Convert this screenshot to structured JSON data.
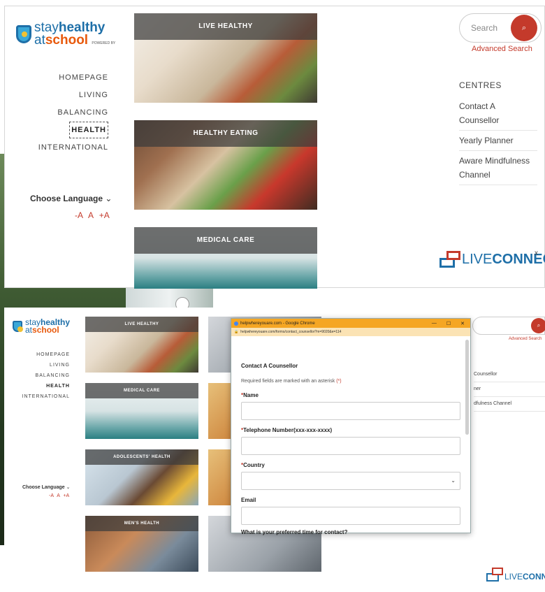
{
  "logo": {
    "line1_a": "stay",
    "line1_b": "healthy",
    "line2_a": "at",
    "line2_b": "school",
    "tag": "POWERED BY"
  },
  "nav": [
    "HOMEPAGE",
    "LIVING",
    "BALANCING",
    "HEALTH",
    "INTERNATIONAL"
  ],
  "nav_active": "HEALTH",
  "language": {
    "label": "Choose Language",
    "chevron": "⌄",
    "font_controls": [
      "-A",
      "A",
      "+A"
    ]
  },
  "tiles_top": [
    "LIVE HEALTHY",
    "HEALTHY EATING",
    "MEDICAL CARE"
  ],
  "search": {
    "placeholder": "Search",
    "advanced": "Advanced Search",
    "icon": "search-icon"
  },
  "centres": {
    "heading": "CENTRES",
    "items": [
      "Contact A Counsellor",
      "Yearly Planner",
      "Aware Mindfulness Channel"
    ]
  },
  "liveconnect": {
    "a": "LIVE",
    "b": "CONNECT",
    "close": "x"
  },
  "tiles_bottom": [
    "LIVE HEALTHY",
    "MEDICAL CARE",
    "ADOLESCENTS' HEALTH",
    "MEN'S HEALTH"
  ],
  "centres_small": [
    "Counsellor",
    "ner",
    "dfulness Channel"
  ],
  "popup": {
    "window_title": "helpwhereyouare.com - Google Chrome",
    "url": "helpwhereyouare.com/forms/contact_counsellor?m=9020&e=114",
    "heading": "Contact A Counsellor",
    "note": "Required fields are marked with an asterisk",
    "note_ast": "(*)",
    "fields": [
      {
        "label": "Name",
        "required": true
      },
      {
        "label": "Telephone Number(xxx-xxx-xxxx)",
        "required": true
      },
      {
        "label": "Country",
        "required": true
      },
      {
        "label": "Email",
        "required": false
      }
    ],
    "question": "What is your preferred time for contact?",
    "controls": [
      "—",
      "☐",
      "✕"
    ],
    "dropdown_chevron": "⌄",
    "ast": "*"
  },
  "colors": {
    "brand_blue": "#1e6fa8",
    "accent_red": "#c43a2b",
    "accent_orange": "#e8590c"
  }
}
